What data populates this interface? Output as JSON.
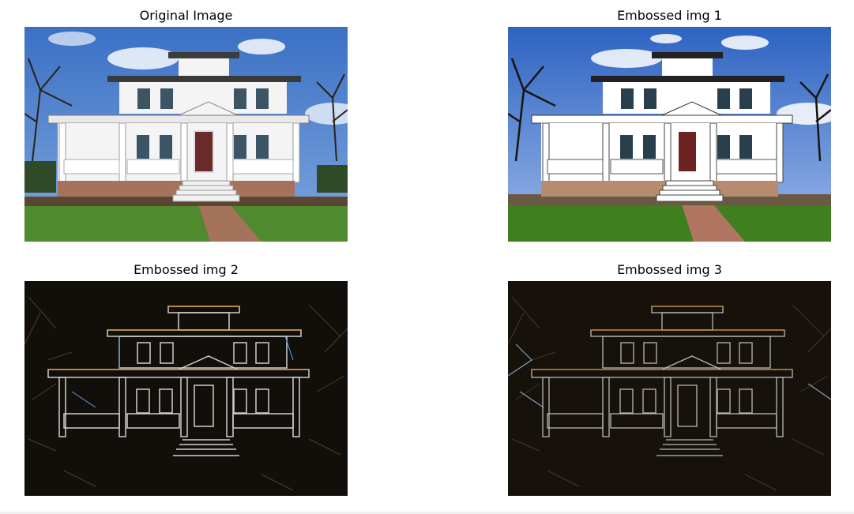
{
  "panels": [
    {
      "id": "original",
      "title": "Original Image",
      "style": "photo"
    },
    {
      "id": "emboss1",
      "title": "Embossed img 1",
      "style": "emboss-light"
    },
    {
      "id": "emboss2",
      "title": "Embossed img 2",
      "style": "emboss-dark"
    },
    {
      "id": "emboss3",
      "title": "Embossed img 3",
      "style": "emboss-dark"
    }
  ],
  "colors": {
    "sky": "#4a7fd0",
    "cloud": "#eef3fb",
    "house": "#f4f4f4",
    "lawn": "#4f8a2e",
    "brick": "#a5735b",
    "door": "#6b2a2a",
    "dark_bg": "#0f0c09",
    "edge": "#d8d8d8"
  }
}
